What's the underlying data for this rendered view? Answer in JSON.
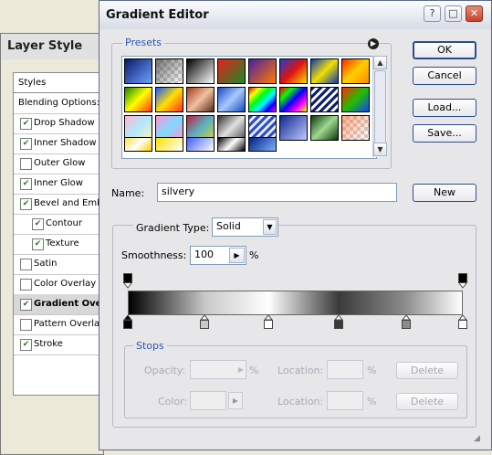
{
  "layer_style": {
    "title": "Layer Style",
    "styles_header": "Styles",
    "items": [
      {
        "label": "Blending Options: D",
        "checkbox": false,
        "checked": false,
        "sub": false,
        "selected": false
      },
      {
        "label": "Drop Shadow",
        "checkbox": true,
        "checked": true,
        "sub": false,
        "selected": false
      },
      {
        "label": "Inner Shadow",
        "checkbox": true,
        "checked": true,
        "sub": false,
        "selected": false
      },
      {
        "label": "Outer Glow",
        "checkbox": true,
        "checked": false,
        "sub": false,
        "selected": false
      },
      {
        "label": "Inner Glow",
        "checkbox": true,
        "checked": true,
        "sub": false,
        "selected": false
      },
      {
        "label": "Bevel and Embo",
        "checkbox": true,
        "checked": true,
        "sub": false,
        "selected": false
      },
      {
        "label": "Contour",
        "checkbox": true,
        "checked": true,
        "sub": true,
        "selected": false
      },
      {
        "label": "Texture",
        "checkbox": true,
        "checked": true,
        "sub": true,
        "selected": false
      },
      {
        "label": "Satin",
        "checkbox": true,
        "checked": false,
        "sub": false,
        "selected": false
      },
      {
        "label": "Color Overlay",
        "checkbox": true,
        "checked": false,
        "sub": false,
        "selected": false
      },
      {
        "label": "Gradient Overl",
        "checkbox": true,
        "checked": true,
        "sub": false,
        "selected": true
      },
      {
        "label": "Pattern Overlay",
        "checkbox": true,
        "checked": false,
        "sub": false,
        "selected": false
      },
      {
        "label": "Stroke",
        "checkbox": true,
        "checked": true,
        "sub": false,
        "selected": false
      }
    ]
  },
  "editor": {
    "title": "Gradient Editor",
    "title_buttons": {
      "help": "?",
      "maximize": "□",
      "close": "✕"
    },
    "presets_label": "Presets",
    "presets_menu_icon": "arrow-right-circle-icon",
    "buttons": {
      "ok": "OK",
      "cancel": "Cancel",
      "load": "Load...",
      "save": "Save...",
      "new": "New"
    },
    "name_label": "Name:",
    "name_value": "silvery",
    "gradient_type_label": "Gradient Type:",
    "gradient_type_value": "Solid",
    "smoothness_label": "Smoothness:",
    "smoothness_value": "100",
    "smoothness_unit": "%",
    "stops": {
      "label": "Stops",
      "opacity_label": "Opacity:",
      "opacity_unit": "%",
      "location_label": "Location:",
      "location_unit": "%",
      "delete_label": "Delete",
      "color_label": "Color:",
      "color_location_label": "Location:",
      "color_location_unit": "%",
      "color_delete_label": "Delete"
    },
    "gradient_bar": {
      "colors": [
        "#000000",
        "#c8c8c8",
        "#ffffff",
        "#3a3a3a",
        "#8c8c8c",
        "#ffffff"
      ],
      "color_stop_locations": [
        0,
        23,
        42,
        63,
        83,
        100
      ],
      "opacity_stop_locations": [
        0,
        100
      ]
    },
    "presets": [
      [
        "linear-gradient(135deg,#0a1a6e,#6fa0ff)",
        "checker-fade",
        "linear-gradient(135deg,#000,#fff)",
        "linear-gradient(135deg,#e8201a,#1a8a2a)",
        "linear-gradient(135deg,#4b1fa3,#ff7a00)",
        "linear-gradient(135deg,#1d3fcf,#e01010,#f4e000)",
        "linear-gradient(135deg,#1038b8,#f0e000,#1038b8)",
        "linear-gradient(135deg,#ff2a00,#ffcf00,#ff8a00)"
      ],
      [
        "linear-gradient(135deg,#118800,#ffff00,#ff3a00)",
        "linear-gradient(135deg,#1a56ff,#ffe000,#ff3020)",
        "linear-gradient(135deg,#a03c1a,#f0c0a0,#5a2a1a)",
        "linear-gradient(135deg,#1a4ac0,#a8c8ff,#1a4ac0)",
        "linear-gradient(135deg,#ff0000,#ffff00,#00ff00,#00ffff,#0000ff,#ff00ff)",
        "linear-gradient(135deg,#ff0000,#00ff00,#0000ff,#ff00ff,#ffff00)",
        "stripes-blue",
        "linear-gradient(135deg,#ff2a00,#20c000,#1040ff)"
      ],
      [
        "linear-gradient(135deg,#ffb8c8,#b0e8ff,#fff2b0)",
        "linear-gradient(135deg,#ff98d0,#80d8ff,#ff98d0)",
        "linear-gradient(135deg,#c02040,#5ab0c0,#d0d040)",
        "linear-gradient(135deg,#303030,#e0e0e0,#505050)",
        "stripes-blue-white",
        "linear-gradient(135deg,#102890,#c0c8ff)",
        "linear-gradient(135deg,#0a3a0a,#a0d890,#0a3a0a)",
        "checker-red"
      ],
      [
        "linear-gradient(135deg,#ffe040,#ffffff,#ffd000)",
        "linear-gradient(135deg,#ffe000,#ffffff)",
        "linear-gradient(135deg,#4060ff,#ffffff)",
        "linear-gradient(135deg,#000,#fff,#000)",
        "linear-gradient(135deg,#002080,#80b0ff)",
        "",
        "",
        ""
      ]
    ]
  }
}
